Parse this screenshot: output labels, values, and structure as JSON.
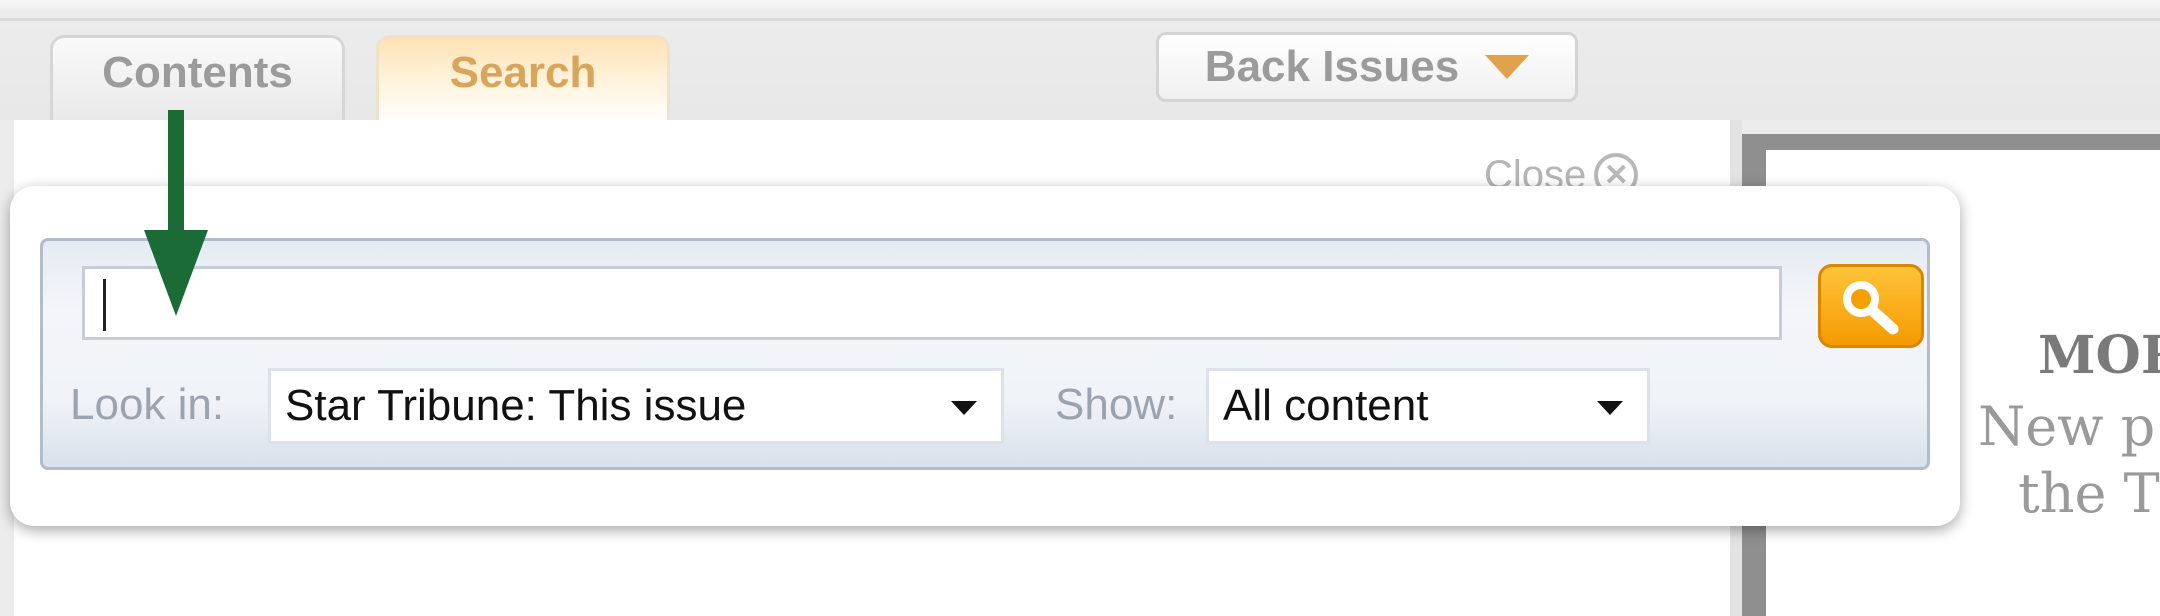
{
  "tabs": [
    {
      "label": "Contents",
      "state": "inactive"
    },
    {
      "label": "Search",
      "state": "active"
    }
  ],
  "back_issues": {
    "label": "Back Issues",
    "icon": "triangle-down-icon"
  },
  "close": {
    "label": "Close",
    "icon": "close-circle-icon"
  },
  "search": {
    "value": "",
    "button_icon": "magnifier-icon",
    "look_in": {
      "label": "Look in:",
      "selected": "Star Tribune: This issue"
    },
    "show": {
      "label": "Show:",
      "selected": "All content"
    }
  },
  "promo": {
    "title": "MOR",
    "line1": "New p",
    "line2": "the T"
  },
  "colors": {
    "active_tab_text": "#d8a55a",
    "search_button": "#f5a000",
    "annotation_arrow": "#1a6b36"
  }
}
